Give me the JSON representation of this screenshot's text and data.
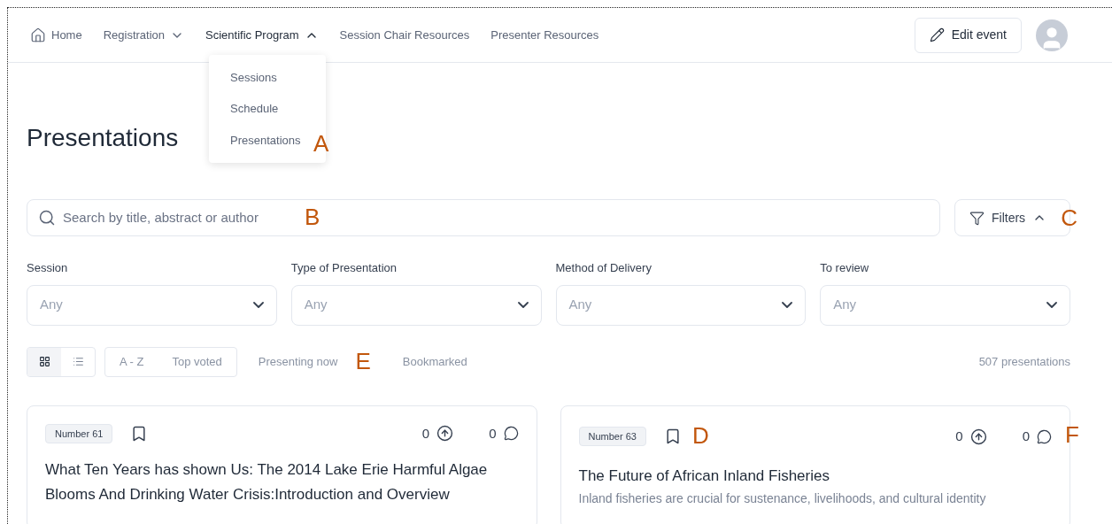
{
  "nav": {
    "items": [
      {
        "label": "Home",
        "kind": "home",
        "expanded": false
      },
      {
        "label": "Registration",
        "kind": "dropdown",
        "expanded": false
      },
      {
        "label": "Scientific Program",
        "kind": "dropdown",
        "expanded": true
      },
      {
        "label": "Session Chair Resources",
        "kind": "link",
        "expanded": false
      },
      {
        "label": "Presenter Resources",
        "kind": "link",
        "expanded": false
      }
    ],
    "menu": [
      "Sessions",
      "Schedule",
      "Presentations"
    ],
    "edit_button": "Edit event"
  },
  "title": "Presentations",
  "search": {
    "placeholder": "Search by title, abstract or author"
  },
  "filters_button": {
    "label": "Filters",
    "expanded": true
  },
  "filters": [
    {
      "label": "Session",
      "placeholder": "Any"
    },
    {
      "label": "Type of Presentation",
      "placeholder": "Any"
    },
    {
      "label": "Method of Delivery",
      "placeholder": "Any"
    },
    {
      "label": "To review",
      "placeholder": "Any"
    }
  ],
  "view_options": [
    {
      "kind": "grid",
      "selected": true
    },
    {
      "kind": "list",
      "selected": false
    }
  ],
  "sort_options": [
    "A - Z",
    "Top voted"
  ],
  "tabs": [
    "Presenting now",
    "Bookmarked"
  ],
  "count": "507 presentations",
  "cards": [
    {
      "number": "Number 61",
      "votes": "0",
      "comments": "0",
      "title": "What Ten Years has shown Us: The 2014 Lake Erie Harmful Algae Blooms And Drinking Water Crisis:Introduction and Overview"
    },
    {
      "number": "Number 63",
      "votes": "0",
      "comments": "0",
      "title": "The Future of African Inland Fisheries",
      "abstract": "Inland fisheries are crucial for sustenance, livelihoods, and cultural identity"
    }
  ],
  "annotations": {
    "menu": "A",
    "search": "B",
    "filters": "C",
    "bookmark": "D",
    "tabs": "E",
    "comments": "F"
  }
}
